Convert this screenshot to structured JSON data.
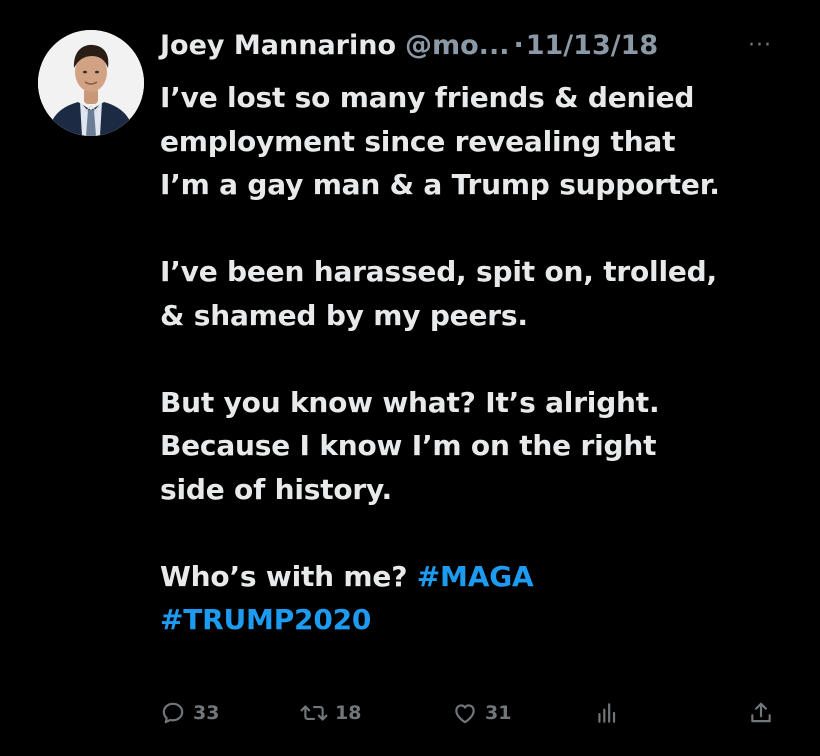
{
  "tweet": {
    "author": {
      "name": "Joey Mannarino",
      "handle": "@mo...",
      "separator": "·",
      "date": "11/13/18"
    },
    "more_label": "···",
    "lines": {
      "l1": "I’ve lost so many friends & denied",
      "l2": "employment since revealing that",
      "l3": "I’m a gay man & a Trump supporter.",
      "l4": "I’ve been harassed, spit on, trolled,",
      "l5": "& shamed by my peers.",
      "l6": "But you know what? It’s alright.",
      "l7": "Because I know I’m on the right",
      "l8": "side of history.",
      "l9": "Who’s with me? ",
      "hashtag1": "#MAGA",
      "hashtag2": "#TRUMP2020"
    },
    "actions": {
      "replies": "33",
      "retweets": "18",
      "likes": "31"
    },
    "icons": {
      "reply": "reply-icon",
      "retweet": "retweet-icon",
      "like": "heart-icon",
      "views": "analytics-icon",
      "share": "share-icon"
    },
    "colors": {
      "background": "#000000",
      "text": "#e7e9ea",
      "muted": "#71767b",
      "hashtag": "#1d9bf0"
    }
  }
}
